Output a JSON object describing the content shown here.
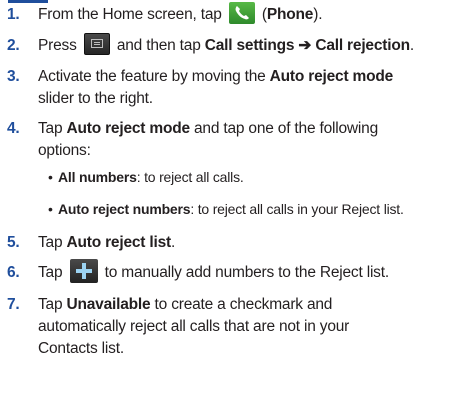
{
  "steps": [
    {
      "num": "1.",
      "pre": "From the Home screen, tap",
      "icon": "phone-app-icon",
      "bold": "Phone",
      "open": " (",
      "close": ")."
    },
    {
      "num": "2.",
      "pre": "Press",
      "icon": "menu-key-icon",
      "mid": " and then tap ",
      "bold1": "Call settings",
      "arrow": " ➔ ",
      "bold2": "Call rejection",
      "end": "."
    },
    {
      "num": "3.",
      "pre": "Activate the feature by moving the ",
      "bold": "Auto reject mode",
      "line2": "slider to the right."
    },
    {
      "num": "4.",
      "pre": "Tap ",
      "bold": "Auto reject mode",
      "post": " and tap one of the following",
      "line2": "options:"
    },
    {
      "num": "5.",
      "pre": "Tap ",
      "bold": "Auto reject list",
      "end": "."
    },
    {
      "num": "6.",
      "pre": "Tap",
      "icon": "add-plus-icon",
      "post": " to manually add numbers to the Reject list."
    },
    {
      "num": "7.",
      "pre": "Tap ",
      "bold": "Unavailable",
      "post": " to create a checkmark and",
      "line2": "automatically reject all calls that are not in your",
      "line3": "Contacts list."
    }
  ],
  "options": [
    {
      "bullet": "•",
      "bold": "All numbers",
      "text": ": to reject all calls."
    },
    {
      "bullet": "•",
      "bold": "Auto reject numbers",
      "text": ": to reject all calls in your Reject list."
    }
  ],
  "colors": {
    "step_number": "#1f4e9c",
    "phone_icon": "#3aa03a",
    "plus_icon": "#9cd3f2"
  }
}
